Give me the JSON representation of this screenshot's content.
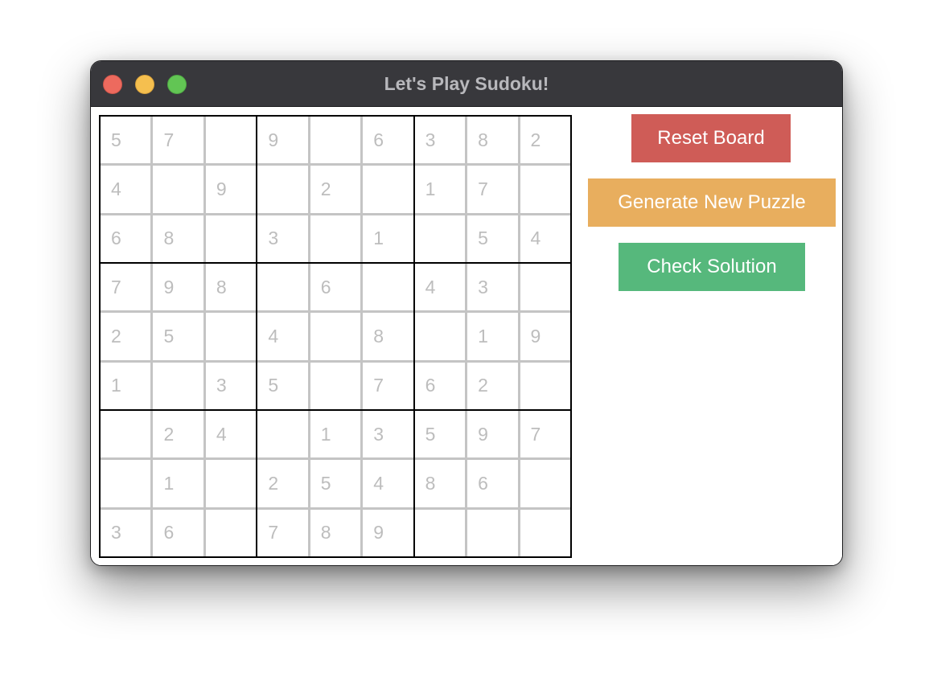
{
  "window": {
    "title": "Let's Play Sudoku!"
  },
  "buttons": {
    "reset": {
      "label": "Reset Board",
      "color": "#cf5c57"
    },
    "generate": {
      "label": "Generate New Puzzle",
      "color": "#e8ae5e"
    },
    "check": {
      "label": "Check Solution",
      "color": "#56b87c"
    }
  },
  "colors": {
    "titlebar": "#38383c",
    "given_digit": "#bdbdbd",
    "cell_divider": "#c4c4c4",
    "box_divider": "#000000"
  },
  "board": {
    "rows": [
      [
        "5",
        "7",
        "",
        "9",
        "",
        "6",
        "3",
        "8",
        "2"
      ],
      [
        "4",
        "",
        "9",
        "",
        "2",
        "",
        "1",
        "7",
        ""
      ],
      [
        "6",
        "8",
        "",
        "3",
        "",
        "1",
        "",
        "5",
        "4"
      ],
      [
        "7",
        "9",
        "8",
        "",
        "6",
        "",
        "4",
        "3",
        ""
      ],
      [
        "2",
        "5",
        "",
        "4",
        "",
        "8",
        "",
        "1",
        "9"
      ],
      [
        "1",
        "",
        "3",
        "5",
        "",
        "7",
        "6",
        "2",
        ""
      ],
      [
        "",
        "2",
        "4",
        "",
        "1",
        "3",
        "5",
        "9",
        "7"
      ],
      [
        "",
        "1",
        "",
        "2",
        "5",
        "4",
        "8",
        "6",
        ""
      ],
      [
        "3",
        "6",
        "",
        "7",
        "8",
        "9",
        "",
        "",
        ""
      ]
    ]
  }
}
